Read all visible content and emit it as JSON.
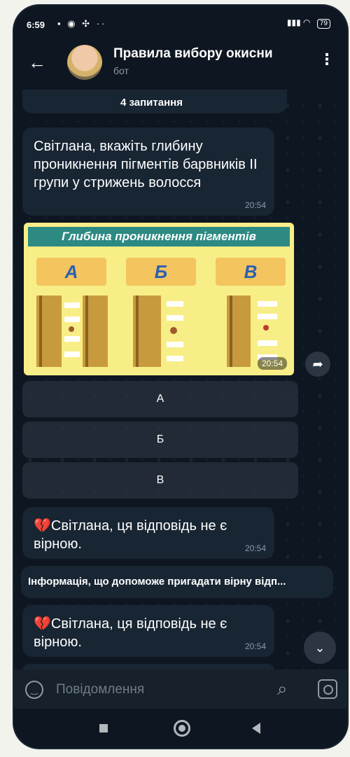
{
  "status": {
    "time": "6:59",
    "left_icons": "▪ ◉ ✣ ··",
    "battery": "79"
  },
  "header": {
    "title": "Правила вибору окисни",
    "subtitle": "бот"
  },
  "messages": {
    "top_partial": "4 запитання",
    "question": "Світлана, вкажіть глибину проникнення пігментів барвників ІІ групи у стрижень волосся",
    "question_time": "20:54",
    "image_title": "Глибина проникнення пігментів",
    "image_options": [
      "А",
      "Б",
      "В"
    ],
    "image_time": "20:54",
    "wrong_1": "💔Світлана, ця відповідь не є вірною.",
    "wrong_1_time": "20:54",
    "info": "Інформація, що допоможе пригадати вірну відп...",
    "wrong_2": "💔Світлана, ця відповідь не є вірною.",
    "wrong_2_time": "20:54"
  },
  "answer_buttons": [
    "А",
    "Б",
    "В"
  ],
  "input": {
    "placeholder": "Повідомлення"
  },
  "colors": {
    "chat_bg": "#0e1621",
    "bubble": "#182533",
    "accent": "#2d8a83",
    "image_bg": "#f8ee87"
  }
}
